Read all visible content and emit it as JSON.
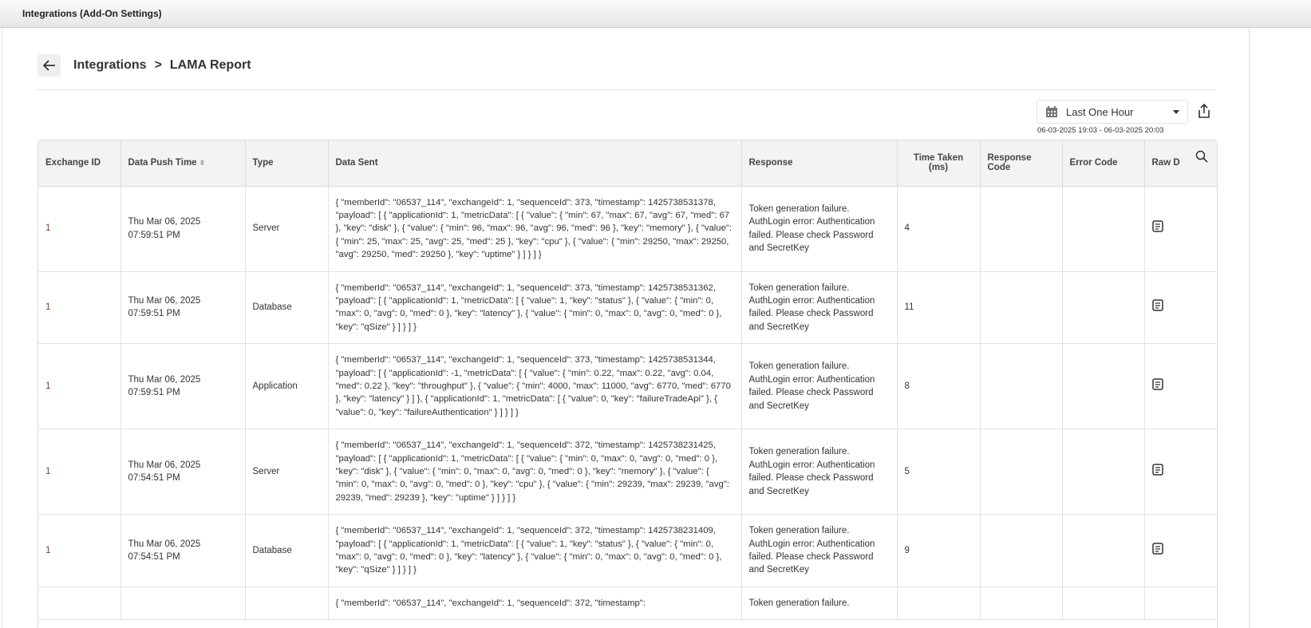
{
  "window_title": "Integrations (Add-On Settings)",
  "breadcrumb": {
    "parent": "Integrations",
    "separator": ">",
    "current": "LAMA Report"
  },
  "filter": {
    "selected": "Last One Hour",
    "range": "06-03-2025 19:03 - 06-03-2025 20:03"
  },
  "columns": [
    "Exchange ID",
    "Data Push Time",
    "Type",
    "Data Sent",
    "Response",
    "Time Taken (ms)",
    "Response Code",
    "Error Code",
    "Raw D"
  ],
  "rows": [
    {
      "exchange_id": "1",
      "push_time": "Thu Mar 06, 2025 07:59:51 PM",
      "type": "Server",
      "data_sent": "{ \"memberId\": \"06537_114\", \"exchangeId\": 1, \"sequenceId\": 373, \"timestamp\": 1425738531378, \"payload\": [ { \"applicationId\": 1, \"metricData\": [ { \"value\": { \"min\": 67, \"max\": 67, \"avg\": 67, \"med\": 67 }, \"key\": \"disk\" }, { \"value\": { \"min\": 96, \"max\": 96, \"avg\": 96, \"med\": 96 }, \"key\": \"memory\" }, { \"value\": { \"min\": 25, \"max\": 25, \"avg\": 25, \"med\": 25 }, \"key\": \"cpu\" }, { \"value\": { \"min\": 29250, \"max\": 29250, \"avg\": 29250, \"med\": 29250 }, \"key\": \"uptime\" } ] } ] }",
      "response": "Token generation failure. AuthLogin error: Authentication failed. Please check Password and SecretKey",
      "time_taken": "4",
      "response_code": "",
      "error_code": ""
    },
    {
      "exchange_id": "1",
      "push_time": "Thu Mar 06, 2025 07:59:51 PM",
      "type": "Database",
      "data_sent": "{ \"memberId\": \"06537_114\", \"exchangeId\": 1, \"sequenceId\": 373, \"timestamp\": 1425738531362, \"payload\": [ { \"applicationId\": 1, \"metricData\": [ { \"value\": 1, \"key\": \"status\" }, { \"value\": { \"min\": 0, \"max\": 0, \"avg\": 0, \"med\": 0 }, \"key\": \"latency\" }, { \"value\": { \"min\": 0, \"max\": 0, \"avg\": 0, \"med\": 0 }, \"key\": \"qSize\" } ] } ] }",
      "response": "Token generation failure. AuthLogin error: Authentication failed. Please check Password and SecretKey",
      "time_taken": "11",
      "response_code": "",
      "error_code": ""
    },
    {
      "exchange_id": "1",
      "push_time": "Thu Mar 06, 2025 07:59:51 PM",
      "type": "Application",
      "data_sent": "{ \"memberId\": \"06537_114\", \"exchangeId\": 1, \"sequenceId\": 373, \"timestamp\": 1425738531344, \"payload\": [ { \"applicationId\": -1, \"metricData\": [ { \"value\": { \"min\": 0.22, \"max\": 0.22, \"avg\": 0.04, \"med\": 0.22 }, \"key\": \"throughput\" }, { \"value\": { \"min\": 4000, \"max\": 11000, \"avg\": 6770, \"med\": 6770 }, \"key\": \"latency\" } ] }, { \"applicationId\": 1, \"metricData\": [ { \"value\": 0, \"key\": \"failureTradeApi\" }, { \"value\": 0, \"key\": \"failureAuthentication\" } ] } ] }",
      "response": "Token generation failure. AuthLogin error: Authentication failed. Please check Password and SecretKey",
      "time_taken": "8",
      "response_code": "",
      "error_code": ""
    },
    {
      "exchange_id": "1",
      "push_time": "Thu Mar 06, 2025 07:54:51 PM",
      "type": "Server",
      "data_sent": "{ \"memberId\": \"06537_114\", \"exchangeId\": 1, \"sequenceId\": 372, \"timestamp\": 1425738231425, \"payload\": [ { \"applicationId\": 1, \"metricData\": [ { \"value\": { \"min\": 0, \"max\": 0, \"avg\": 0, \"med\": 0 }, \"key\": \"disk\" }, { \"value\": { \"min\": 0, \"max\": 0, \"avg\": 0, \"med\": 0 }, \"key\": \"memory\" }, { \"value\": { \"min\": 0, \"max\": 0, \"avg\": 0, \"med\": 0 }, \"key\": \"cpu\" }, { \"value\": { \"min\": 29239, \"max\": 29239, \"avg\": 29239, \"med\": 29239 }, \"key\": \"uptime\" } ] } ] }",
      "response": "Token generation failure. AuthLogin error: Authentication failed. Please check Password and SecretKey",
      "time_taken": "5",
      "response_code": "",
      "error_code": ""
    },
    {
      "exchange_id": "1",
      "push_time": "Thu Mar 06, 2025 07:54:51 PM",
      "type": "Database",
      "data_sent": "{ \"memberId\": \"06537_114\", \"exchangeId\": 1, \"sequenceId\": 372, \"timestamp\": 1425738231409, \"payload\": [ { \"applicationId\": 1, \"metricData\": [ { \"value\": 1, \"key\": \"status\" }, { \"value\": { \"min\": 0, \"max\": 0, \"avg\": 0, \"med\": 0 }, \"key\": \"latency\" }, { \"value\": { \"min\": 0, \"max\": 0, \"avg\": 0, \"med\": 0 }, \"key\": \"qSize\" } ] } ] }",
      "response": "Token generation failure. AuthLogin error: Authentication failed. Please check Password and SecretKey",
      "time_taken": "9",
      "response_code": "",
      "error_code": ""
    },
    {
      "exchange_id": "",
      "push_time": "",
      "type": "",
      "data_sent": "{ \"memberId\": \"06537_114\", \"exchangeId\": 1, \"sequenceId\": 372, \"timestamp\":",
      "response": "Token generation failure.",
      "time_taken": "",
      "response_code": "",
      "error_code": ""
    }
  ]
}
